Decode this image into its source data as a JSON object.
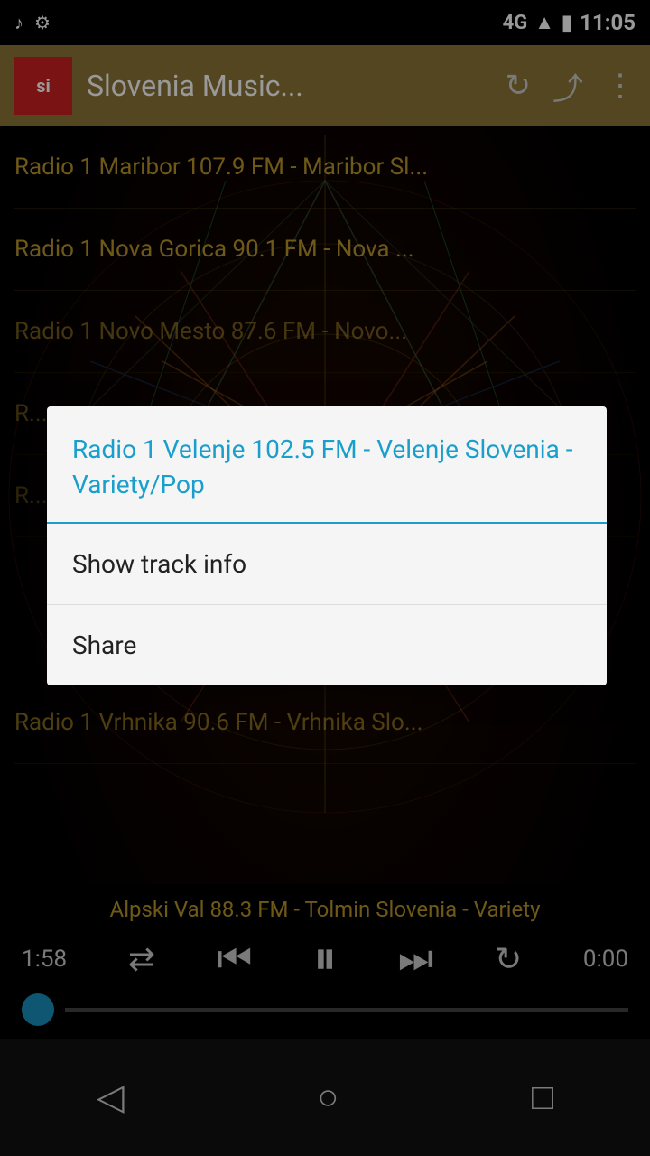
{
  "statusBar": {
    "network": "4G",
    "time": "11:05",
    "icons": {
      "music": "♪",
      "android": "⚙",
      "signal": "▲",
      "battery": "🔋"
    }
  },
  "toolbar": {
    "title": "Slovenia Music...",
    "logoText": "si",
    "refreshIcon": "↻",
    "shareIcon": "⤴",
    "moreIcon": "⋮"
  },
  "radioList": {
    "items": [
      "Radio 1 Maribor 107.9 FM - Maribor Sl...",
      "Radio 1 Nova Gorica 90.1 FM - Nova ...",
      "Radio 1 Novo Mesto 87.6 FM - Novo...",
      "R...",
      "R...",
      "Radio 1 Vrhnika 90.6 FM - Vrhnika Slo..."
    ]
  },
  "contextMenu": {
    "title": "Radio 1 Velenje 102.5 FM  -  Velenje Slovenia  - Variety/Pop",
    "items": [
      {
        "label": "Show track info",
        "id": "show-track-info"
      },
      {
        "label": "Share",
        "id": "share"
      }
    ]
  },
  "playerBar": {
    "nowPlaying": "Alpski Val 88.3 FM  -  Tolmin Slovenia  -  Variety",
    "timeElapsed": "1:58",
    "timeRemaining": "0:00",
    "shuffleIcon": "⇄",
    "prevIcon": "⏮",
    "pauseIcon": "⏸",
    "nextIcon": "⏭",
    "repeatIcon": "↻"
  },
  "navBar": {
    "backIcon": "◁",
    "homeIcon": "○",
    "recentIcon": "□"
  }
}
